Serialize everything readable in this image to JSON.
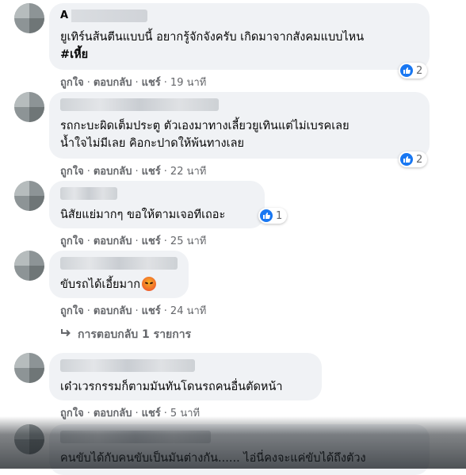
{
  "comments": [
    {
      "name": "A",
      "lines": [
        "ยูเทิร์นส้นตีนแบบนี้ อยากรู้จักจังครับ เกิดมาจากสังคมแบบไหน",
        "#เหี้ย"
      ],
      "actions": {
        "like": "ถูกใจ",
        "reply": "ตอบกลับ",
        "share": "แชร์",
        "time": "19 นาที"
      },
      "reaction_count": "2"
    },
    {
      "name": "",
      "lines": [
        "รถกะบะผิดเต็มประตู ตัวเองมาทางเลี้ยวยูเทินแต่ไม่เบรคเลย",
        "น้ำใจไม่มีเลย คิอกะปาดให้พ้นทางเลย"
      ],
      "actions": {
        "like": "ถูกใจ",
        "reply": "ตอบกลับ",
        "share": "แชร์",
        "time": "22 นาที"
      },
      "reaction_count": "2"
    },
    {
      "name": "",
      "lines": [
        "นิสัยแย่มากๆ ขอให้ตามเจอทีเถอะ"
      ],
      "actions": {
        "like": "ถูกใจ",
        "reply": "ตอบกลับ",
        "share": "แชร์",
        "time": "25 นาที"
      },
      "reaction_count": "1"
    },
    {
      "name": "",
      "lines": [
        "ขับรถได้เอี้ยมาก"
      ],
      "actions": {
        "like": "ถูกใจ",
        "reply": "ตอบกลับ",
        "share": "แชร์",
        "time": "24 นาที"
      },
      "reaction_count": ""
    },
    {
      "name": "",
      "lines": [
        "เด๋วเวรกรรมก็ตามมันทันโดนรถคนอื่นตัดหน้า"
      ],
      "actions": {
        "like": "ถูกใจ",
        "reply": "ตอบกลับ",
        "share": "แชร์",
        "time": "5 นาที"
      },
      "reaction_count": ""
    },
    {
      "name": "",
      "lines": [
        "คนขับได้กับคนขับเป็นมันต่างกัน...... ไอ่นี่คงจะแค่ขับได้ถึงตัวง"
      ],
      "actions": {
        "like": "",
        "reply": "",
        "share": "",
        "time": ""
      },
      "reaction_count": ""
    }
  ],
  "replies_link": "การตอบกลับ 1 รายการ",
  "colors": {
    "bubble": "#f0f2f5",
    "like_blue": "#1877f2",
    "meta_gray": "#65676b"
  },
  "icons": {
    "reaction": "like-thumb-icon",
    "emoji": "angry-face-icon",
    "reply_arrow": "reply-arrow-icon"
  }
}
